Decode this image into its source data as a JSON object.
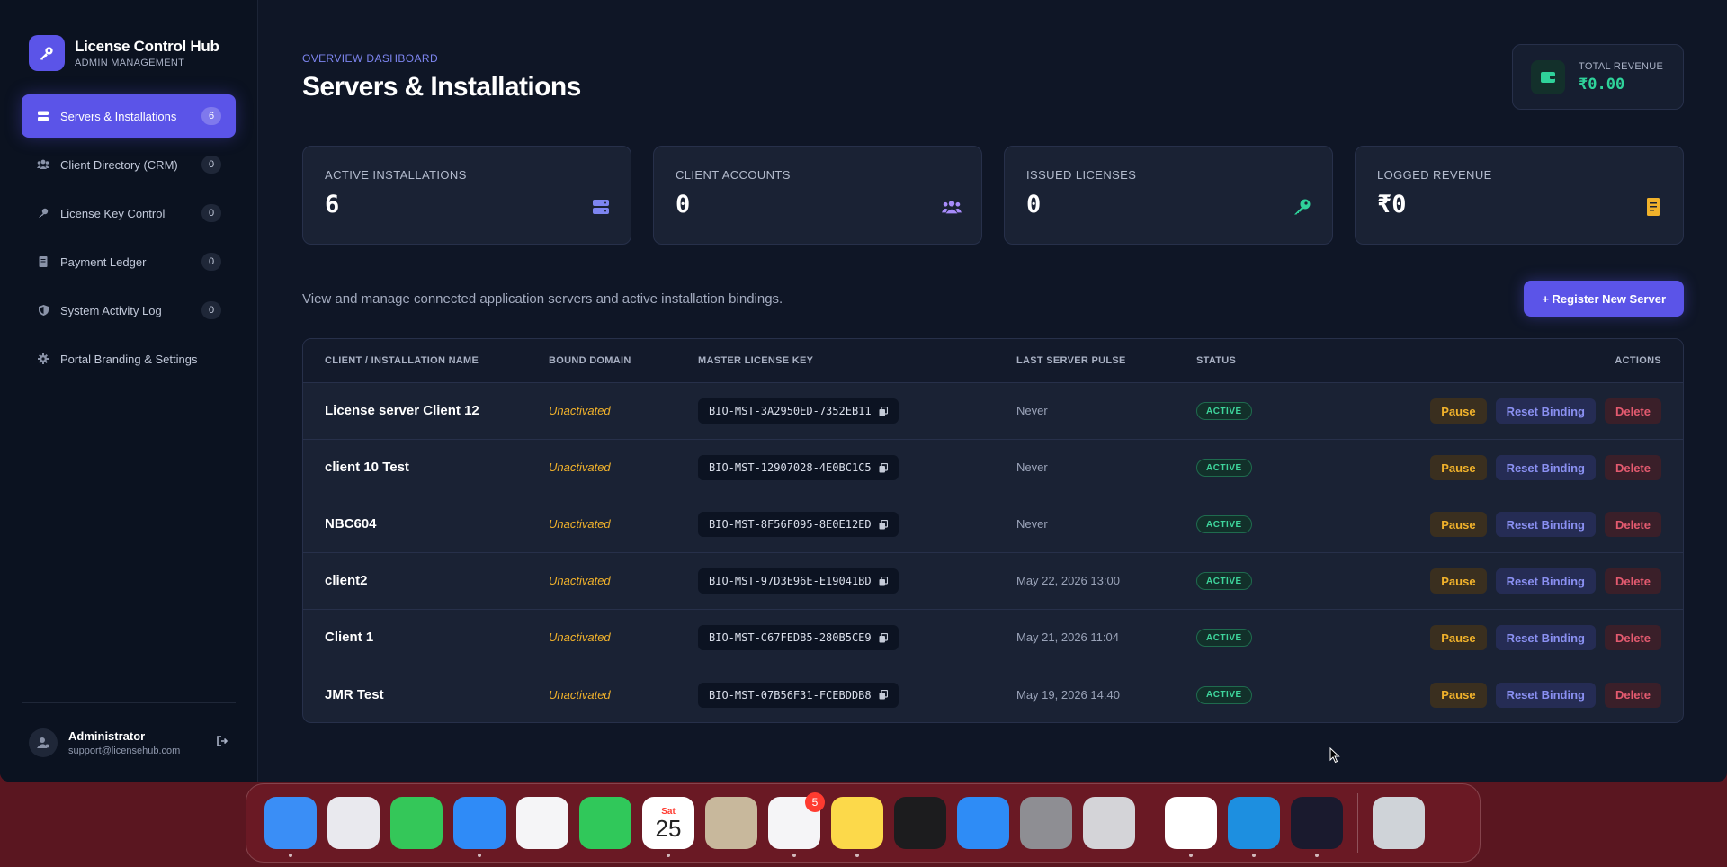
{
  "brand": {
    "title": "License Control Hub",
    "subtitle": "ADMIN MANAGEMENT"
  },
  "sidebar": {
    "items": [
      {
        "label": "Servers & Installations",
        "count": "6",
        "icon": "server-icon"
      },
      {
        "label": "Client Directory (CRM)",
        "count": "0",
        "icon": "users-icon"
      },
      {
        "label": "License Key Control",
        "count": "0",
        "icon": "key-icon"
      },
      {
        "label": "Payment Ledger",
        "count": "0",
        "icon": "receipt-icon"
      },
      {
        "label": "System Activity Log",
        "count": "0",
        "icon": "shield-icon"
      },
      {
        "label": "Portal Branding & Settings",
        "icon": "gear-icon"
      }
    ],
    "user": {
      "name": "Administrator",
      "email": "support@licensehub.com"
    }
  },
  "header": {
    "kicker": "OVERVIEW DASHBOARD",
    "title": "Servers & Installations",
    "revenue_label": "TOTAL REVENUE",
    "revenue_value": "₹0.00"
  },
  "stats": [
    {
      "label": "ACTIVE INSTALLATIONS",
      "value": "6",
      "icon": "server-icon",
      "color": "#7d85f0"
    },
    {
      "label": "CLIENT ACCOUNTS",
      "value": "0",
      "icon": "users-icon",
      "color": "#a78bfa"
    },
    {
      "label": "ISSUED LICENSES",
      "value": "0",
      "icon": "key-icon",
      "color": "#2fd29a"
    },
    {
      "label": "LOGGED REVENUE",
      "value": "₹0",
      "icon": "receipt-icon",
      "color": "#f1b22b"
    }
  ],
  "description": "View and manage connected application servers and active installation bindings.",
  "register_button": "+ Register New Server",
  "table": {
    "headers": [
      "CLIENT / INSTALLATION NAME",
      "BOUND DOMAIN",
      "MASTER LICENSE KEY",
      "LAST SERVER PULSE",
      "STATUS",
      "ACTIONS"
    ],
    "rows": [
      {
        "name": "License server Client 12",
        "domain": "Unactivated",
        "key": "BIO-MST-3A2950ED-7352EB11",
        "pulse": "Never",
        "status": "ACTIVE"
      },
      {
        "name": "client 10 Test",
        "domain": "Unactivated",
        "key": "BIO-MST-12907028-4E0BC1C5",
        "pulse": "Never",
        "status": "ACTIVE"
      },
      {
        "name": "NBC604",
        "domain": "Unactivated",
        "key": "BIO-MST-8F56F095-8E0E12ED",
        "pulse": "Never",
        "status": "ACTIVE"
      },
      {
        "name": "client2",
        "domain": "Unactivated",
        "key": "BIO-MST-97D3E96E-E19041BD",
        "pulse": "May 22, 2026 13:00",
        "status": "ACTIVE"
      },
      {
        "name": "Client 1",
        "domain": "Unactivated",
        "key": "BIO-MST-C67FEDB5-280B5CE9",
        "pulse": "May 21, 2026 11:04",
        "status": "ACTIVE"
      },
      {
        "name": "JMR Test",
        "domain": "Unactivated",
        "key": "BIO-MST-07B56F31-FCEBDDB8",
        "pulse": "May 19, 2026 14:40",
        "status": "ACTIVE"
      }
    ],
    "actions": {
      "pause": "Pause",
      "reset": "Reset Binding",
      "delete": "Delete"
    }
  },
  "dock": {
    "apps": [
      {
        "name": "finder-icon",
        "color": "#3a8ef6",
        "dot": true
      },
      {
        "name": "launchpad-icon",
        "color": "#e9e9ee"
      },
      {
        "name": "messages-icon",
        "color": "#34c759"
      },
      {
        "name": "mail-icon",
        "color": "#2f8bf7",
        "dot": true
      },
      {
        "name": "photos-icon",
        "color": "#f5f5f7"
      },
      {
        "name": "facetime-icon",
        "color": "#30c85a"
      },
      {
        "name": "calendar-icon",
        "color": "#ffffff",
        "dot": true,
        "day": "Sat",
        "date": "25"
      },
      {
        "name": "contacts-icon",
        "color": "#c8b89c"
      },
      {
        "name": "reminders-icon",
        "color": "#f5f5f7",
        "dot": true,
        "badge": "5"
      },
      {
        "name": "notes-icon",
        "color": "#fcd94a",
        "dot": true
      },
      {
        "name": "apple-tv-icon",
        "color": "#1c1c1e"
      },
      {
        "name": "app-store-icon",
        "color": "#2e8cf6"
      },
      {
        "name": "system-settings-icon",
        "color": "#8e8e93"
      },
      {
        "name": "calculator-icon",
        "color": "#d4d4d8"
      }
    ],
    "running": [
      {
        "name": "chrome-icon",
        "color": "#ffffff",
        "dot": true
      },
      {
        "name": "docker-icon",
        "color": "#1d8fe0",
        "dot": true
      },
      {
        "name": "arc-icon",
        "color": "#1a1a2e",
        "dot": true
      }
    ],
    "trash": {
      "name": "trash-icon",
      "color": "#cfd3d8"
    }
  }
}
